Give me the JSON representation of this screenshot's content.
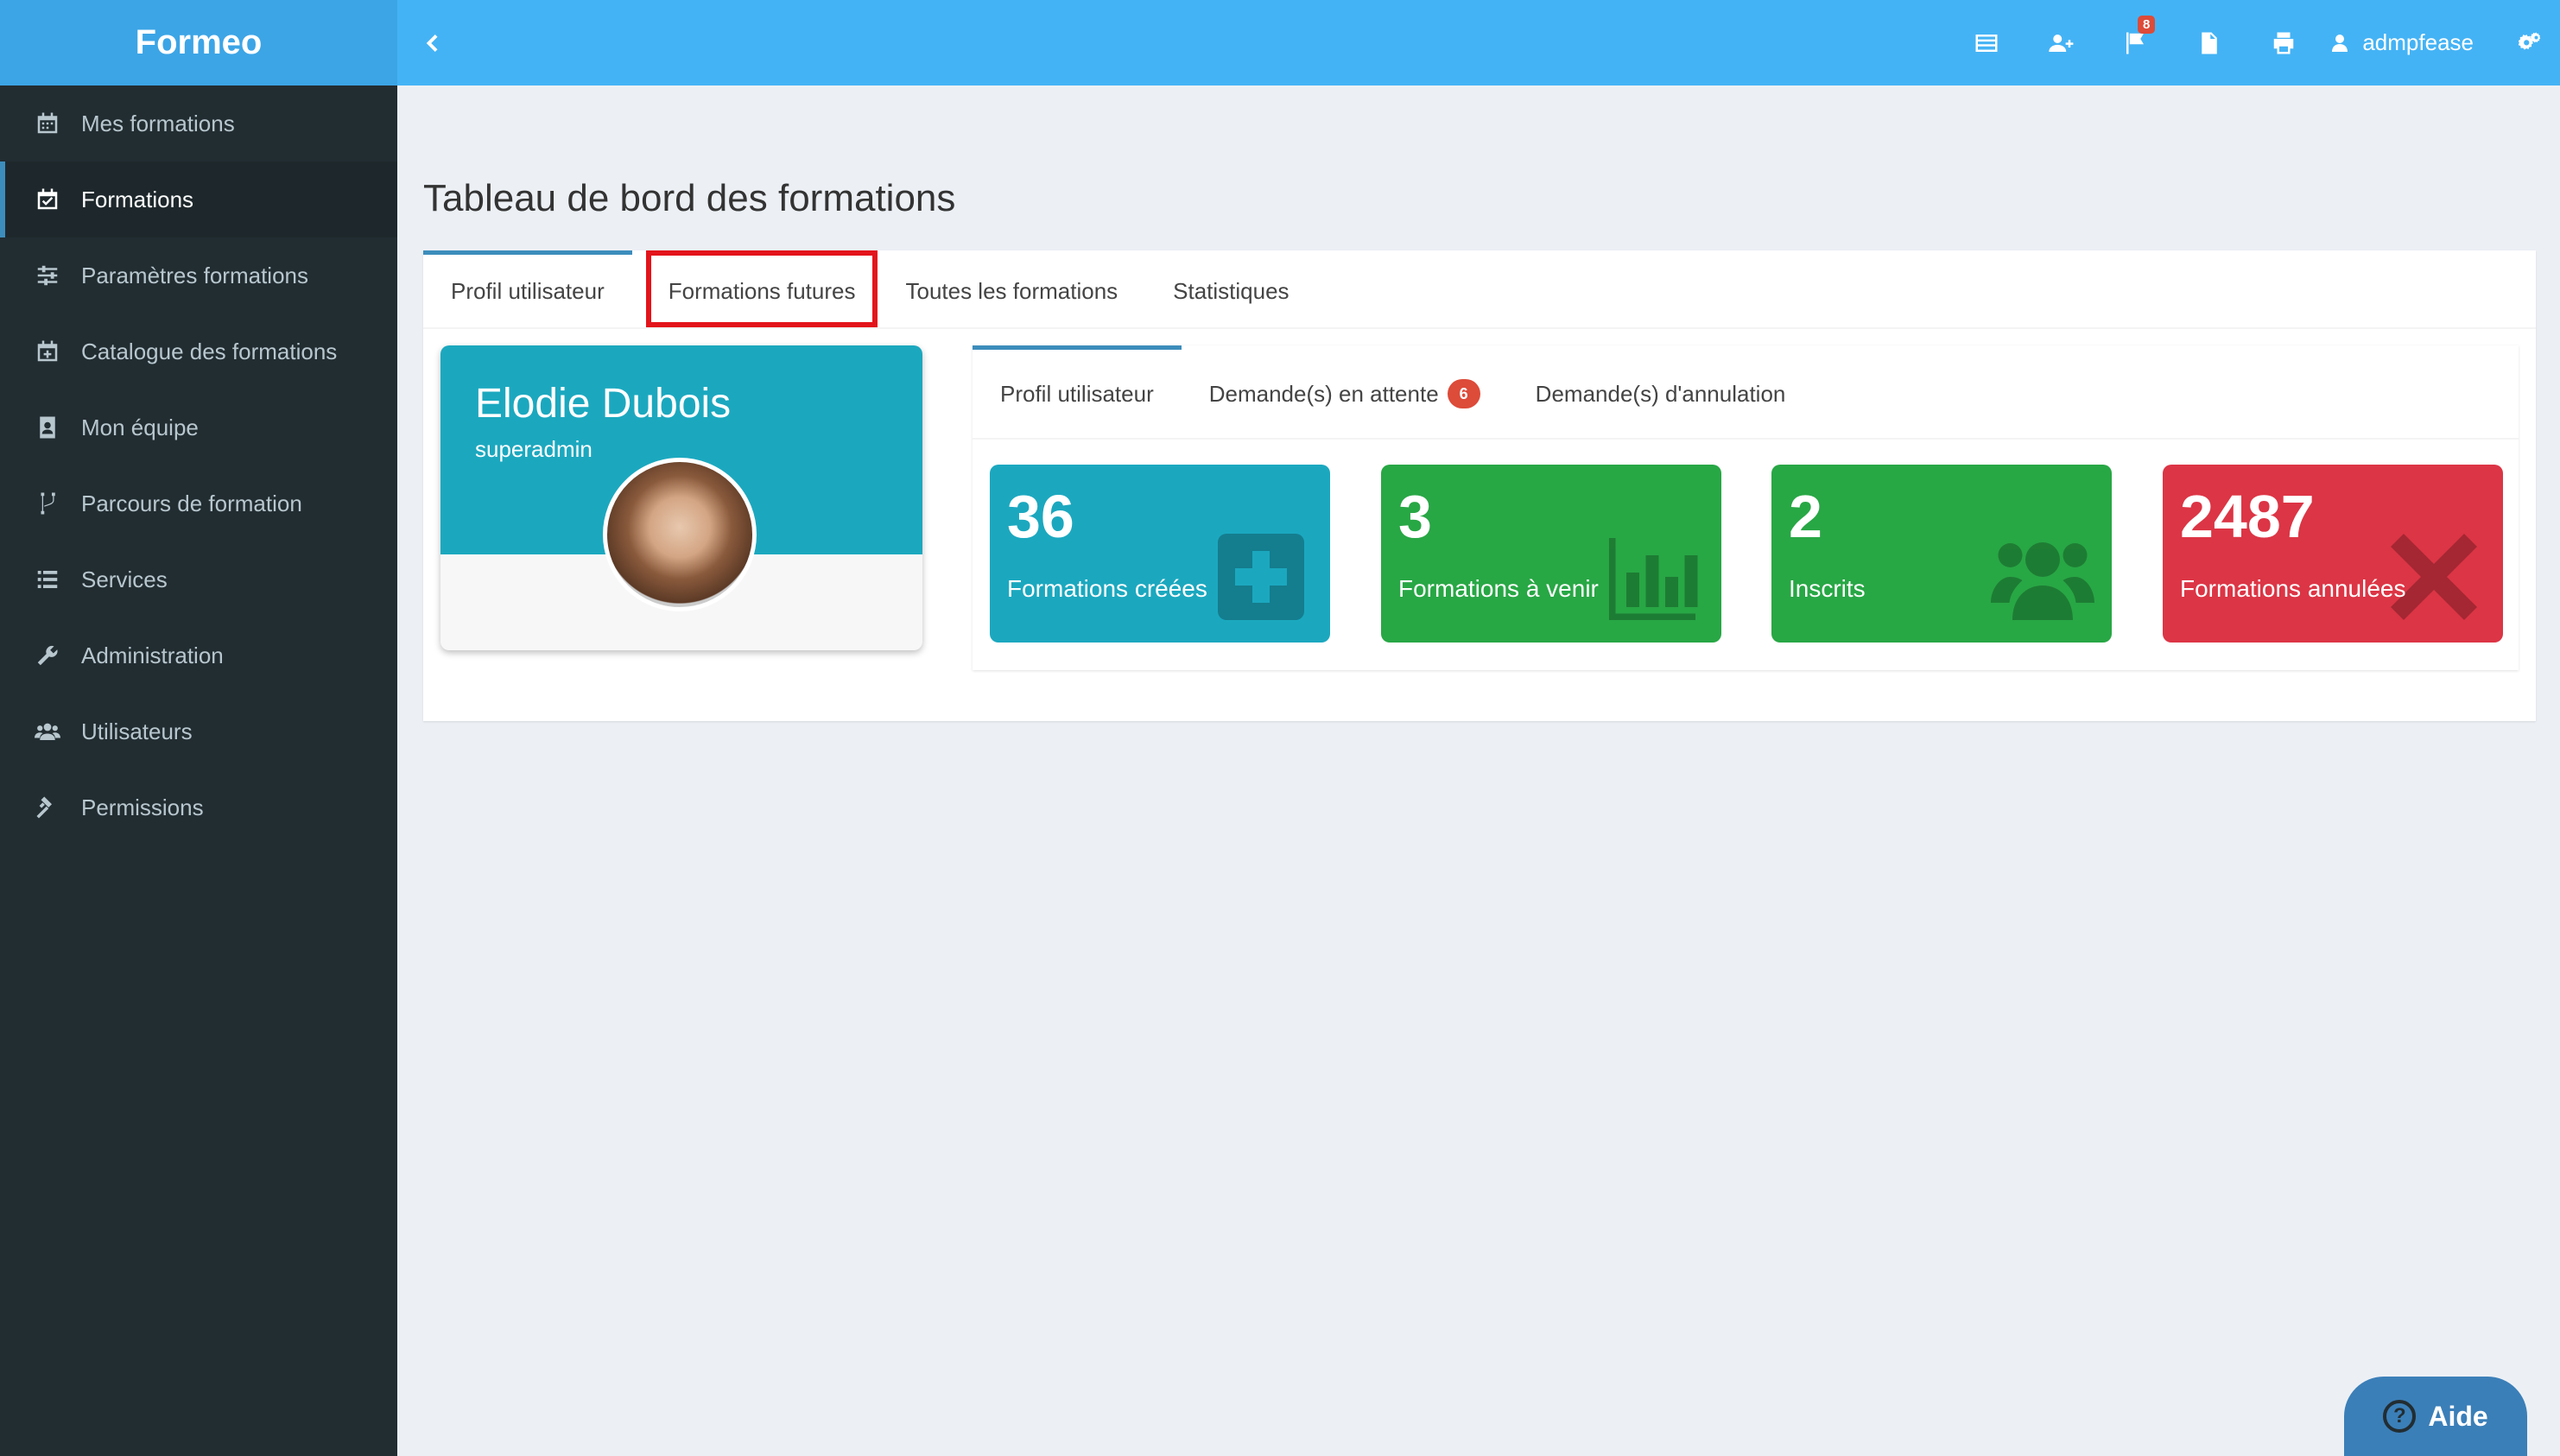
{
  "app": {
    "brand": "Formeo"
  },
  "sidebar": {
    "items": [
      {
        "label": "Mes formations",
        "icon": "calendar-icon",
        "active": false
      },
      {
        "label": "Formations",
        "icon": "calendar-check-icon",
        "active": true
      },
      {
        "label": "Paramètres formations",
        "icon": "sliders-icon",
        "active": false
      },
      {
        "label": "Catalogue des formations",
        "icon": "calendar-plus-icon",
        "active": false
      },
      {
        "label": "Mon équipe",
        "icon": "contact-card-icon",
        "active": false
      },
      {
        "label": "Parcours de formation",
        "icon": "branch-icon",
        "active": false
      },
      {
        "label": "Services",
        "icon": "list-icon",
        "active": false
      },
      {
        "label": "Administration",
        "icon": "wrench-icon",
        "active": false
      },
      {
        "label": "Utilisateurs",
        "icon": "users-icon",
        "active": false
      },
      {
        "label": "Permissions",
        "icon": "gavel-icon",
        "active": false
      }
    ]
  },
  "topbar": {
    "notifications_count": "8",
    "username": "admpfease"
  },
  "page": {
    "title": "Tableau de bord des formations"
  },
  "tabs": [
    {
      "label": "Profil utilisateur",
      "active": true
    },
    {
      "label": "Formations futures",
      "highlighted": true
    },
    {
      "label": "Toutes les formations"
    },
    {
      "label": "Statistiques"
    }
  ],
  "profile": {
    "name": "Elodie Dubois",
    "role": "superadmin"
  },
  "inner_tabs": [
    {
      "label": "Profil utilisateur",
      "active": true
    },
    {
      "label": "Demande(s) en attente",
      "badge": "6"
    },
    {
      "label": "Demande(s) d'annulation"
    }
  ],
  "stats": [
    {
      "value": "36",
      "label": "Formations créées",
      "color": "#1ba8bf",
      "icon": "plus-square-icon"
    },
    {
      "value": "3",
      "label": "Formations à venir",
      "color": "#28a745",
      "icon": "bar-chart-icon"
    },
    {
      "value": "2",
      "label": "Inscrits",
      "color": "#28a745",
      "icon": "users-icon"
    },
    {
      "value": "2487",
      "label": "Formations annulées",
      "color": "#dc3545",
      "icon": "times-icon"
    }
  ],
  "help": {
    "label": "Aide"
  }
}
